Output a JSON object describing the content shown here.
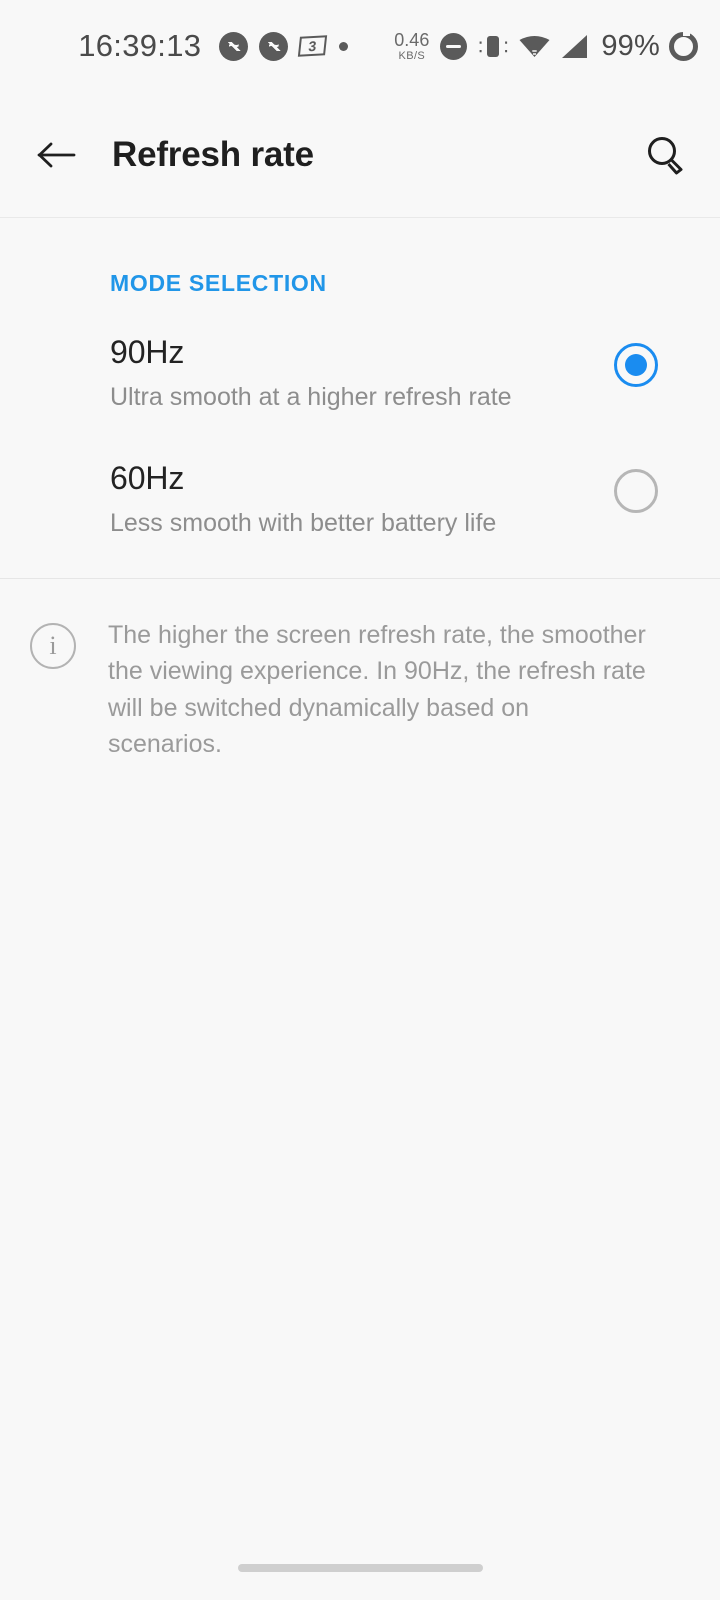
{
  "status_bar": {
    "clock": "16:39:13",
    "notification_icons": [
      "messenger-icon",
      "messenger-icon",
      "badge-3-icon",
      "dot-icon"
    ],
    "badge_label": "3",
    "network_speed_value": "0.46",
    "network_speed_unit": "KB/S",
    "dnd_icon": "do-not-disturb-icon",
    "vibrate_icon": "vibrate-icon",
    "wifi_icon": "wifi-icon",
    "signal_icon": "cellular-signal-icon",
    "battery_percent": "99%",
    "battery_icon": "battery-ring-icon"
  },
  "app_bar": {
    "back_icon": "back-arrow-icon",
    "title": "Refresh rate",
    "search_icon": "search-icon"
  },
  "main": {
    "section_header": "MODE SELECTION",
    "options": [
      {
        "title": "90Hz",
        "subtitle": "Ultra smooth at a higher refresh rate",
        "selected": true
      },
      {
        "title": "60Hz",
        "subtitle": "Less smooth with better battery life",
        "selected": false
      }
    ],
    "info": {
      "icon": "info-icon",
      "text": "The higher the screen refresh rate, the smoother the viewing experience. In 90Hz, the refresh rate will be switched dynamically based on scenarios."
    }
  },
  "nav_bar": {
    "gesture_pill": "home-gesture-pill"
  },
  "colors": {
    "accent": "#2196e8",
    "radio_selected": "#1a8cf0",
    "background": "#f8f8f8",
    "title_text": "#1f1f1f",
    "secondary_text": "#8d8d8d"
  }
}
